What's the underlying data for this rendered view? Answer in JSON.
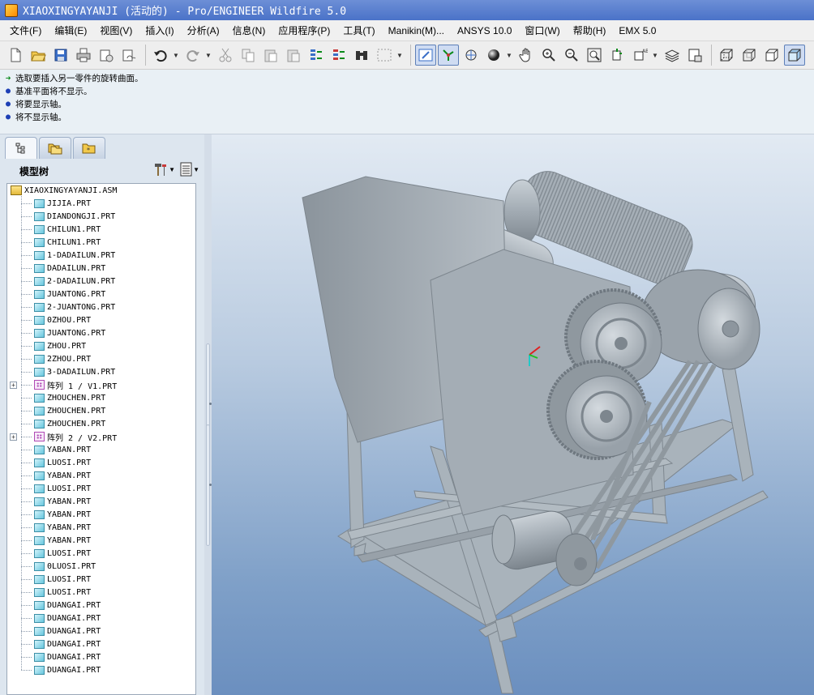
{
  "window": {
    "title": "XIAOXINGYAYANJI (活动的) - Pro/ENGINEER Wildfire 5.0"
  },
  "menu": [
    "文件(F)",
    "编辑(E)",
    "视图(V)",
    "插入(I)",
    "分析(A)",
    "信息(N)",
    "应用程序(P)",
    "工具(T)",
    "Manikin(M)...",
    "ANSYS 10.0",
    "窗口(W)",
    "帮助(H)",
    "EMX 5.0"
  ],
  "messages": [
    {
      "icon": "arrow",
      "text": "选取要插入另一零件的旋转曲面。"
    },
    {
      "icon": "dot",
      "text": "基准平面将不显示。"
    },
    {
      "icon": "dot",
      "text": "将要显示轴。"
    },
    {
      "icon": "dot",
      "text": "将不显示轴。"
    }
  ],
  "model_tree": {
    "title": "模型树",
    "root": "XIAOXINGYAYANJI.ASM",
    "items": [
      {
        "type": "part",
        "label": "JIJIA.PRT"
      },
      {
        "type": "part",
        "label": "DIANDONGJI.PRT"
      },
      {
        "type": "part",
        "label": "CHILUN1.PRT"
      },
      {
        "type": "part",
        "label": "CHILUN1.PRT"
      },
      {
        "type": "part",
        "label": "1-DADAILUN.PRT"
      },
      {
        "type": "part",
        "label": "DADAILUN.PRT"
      },
      {
        "type": "part",
        "label": "2-DADAILUN.PRT"
      },
      {
        "type": "part",
        "label": "JUANTONG.PRT"
      },
      {
        "type": "part",
        "label": "2-JUANTONG.PRT"
      },
      {
        "type": "part",
        "label": "0ZHOU.PRT"
      },
      {
        "type": "part",
        "label": "JUANTONG.PRT"
      },
      {
        "type": "part",
        "label": "ZHOU.PRT"
      },
      {
        "type": "part",
        "label": "2ZHOU.PRT"
      },
      {
        "type": "part",
        "label": "3-DADAILUN.PRT"
      },
      {
        "type": "pattern",
        "label": "阵列 1 / V1.PRT"
      },
      {
        "type": "part",
        "label": "ZHOUCHEN.PRT"
      },
      {
        "type": "part",
        "label": "ZHOUCHEN.PRT"
      },
      {
        "type": "part",
        "label": "ZHOUCHEN.PRT"
      },
      {
        "type": "pattern",
        "label": "阵列 2 / V2.PRT"
      },
      {
        "type": "part",
        "label": "YABAN.PRT"
      },
      {
        "type": "part",
        "label": "LUOSI.PRT"
      },
      {
        "type": "part",
        "label": "YABAN.PRT"
      },
      {
        "type": "part",
        "label": "LUOSI.PRT"
      },
      {
        "type": "part",
        "label": "YABAN.PRT"
      },
      {
        "type": "part",
        "label": "YABAN.PRT"
      },
      {
        "type": "part",
        "label": "YABAN.PRT"
      },
      {
        "type": "part",
        "label": "YABAN.PRT"
      },
      {
        "type": "part",
        "label": "LUOSI.PRT"
      },
      {
        "type": "part",
        "label": "0LUOSI.PRT"
      },
      {
        "type": "part",
        "label": "LUOSI.PRT"
      },
      {
        "type": "part",
        "label": "LUOSI.PRT"
      },
      {
        "type": "part",
        "label": "DUANGAI.PRT"
      },
      {
        "type": "part",
        "label": "DUANGAI.PRT"
      },
      {
        "type": "part",
        "label": "DUANGAI.PRT"
      },
      {
        "type": "part",
        "label": "DUANGAI.PRT"
      },
      {
        "type": "part",
        "label": "DUANGAI.PRT"
      },
      {
        "type": "part",
        "label": "DUANGAI.PRT"
      }
    ]
  },
  "colors": {
    "titlebar": "#4a72c8",
    "model_gray": "#a9b3bb",
    "viewport_bottom": "#6b8fbf"
  }
}
